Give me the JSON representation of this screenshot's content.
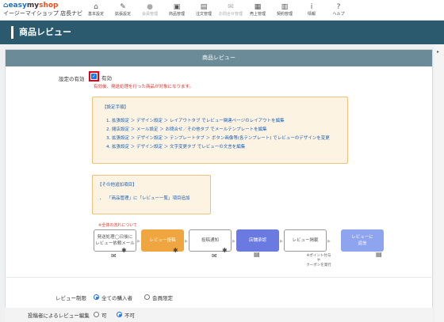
{
  "logo": {
    "brand_easy": "easy",
    "brand_my": "my",
    "brand_shop": "shop",
    "sub": "イージーマイショップ 店長ナビ"
  },
  "nav": [
    {
      "icon": "home-icon",
      "glyph": "⌂",
      "label": "基本設定",
      "dim": false
    },
    {
      "icon": "paint-icon",
      "glyph": "✎",
      "label": "拡張設定",
      "dim": false
    },
    {
      "icon": "person-icon",
      "glyph": "●",
      "label": "会員管理",
      "dim": true
    },
    {
      "icon": "gift-icon",
      "glyph": "▣",
      "label": "商品管理",
      "dim": false
    },
    {
      "icon": "document-icon",
      "glyph": "▤",
      "label": "注文管理",
      "dim": false
    },
    {
      "icon": "mail-icon",
      "glyph": "✉",
      "label": "お問合せ管理",
      "dim": true
    },
    {
      "icon": "calculator-icon",
      "glyph": "▦",
      "label": "売上管理",
      "dim": false
    },
    {
      "icon": "contract-icon",
      "glyph": "▥",
      "label": "契約管理",
      "dim": false
    },
    {
      "icon": "info-icon",
      "glyph": "i",
      "label": "情報",
      "dim": false
    },
    {
      "icon": "help-icon",
      "glyph": "?",
      "label": "ヘルプ",
      "dim": false
    }
  ],
  "page_title": "商品レビュー",
  "panel_title": "商品レビュー",
  "setting": {
    "label": "設定の有効",
    "checkbox_label": "有効",
    "note": "有効後、発送処理を行った商品が対象になります。"
  },
  "steps_box": {
    "title": "【設定手順】",
    "items": [
      "拡張設定 ＞ デザイン設定 ＞ レイアウトタブ でレビュー関連ページのレイアウトを編集",
      "閲店設定 ＞ メール設定 ＞ お問合せ／その他タブ でメールテンプレートを編集",
      "拡張設定 ＞ デザイン設定 ＞ テンプレートタブ ＞ ボタン画像等(各テンプレート) でレビューのデザインを変更",
      "拡張設定 ＞ デザイン設定 ＞ 文字変更タブ でレビューの文言を編集"
    ]
  },
  "extra_box": {
    "title": "【その他追加項目】",
    "items": [
      "「商品管理」に「レビュー一覧」項目追加"
    ]
  },
  "flow": {
    "note": "※全体の流れについて",
    "steps": [
      "発送処理◯日後に\nレビュー依頼メール",
      "レビュー投稿",
      "投稿通知",
      "店舗承認",
      "レビュー掲載",
      "レビューに\n返信"
    ],
    "sub": "※ポイント付与\nや\nクーポンを発行"
  },
  "restriction": {
    "label": "レビュー制限",
    "options": [
      {
        "text": "全ての購入者",
        "selected": true
      },
      {
        "text": "会員限定",
        "selected": false
      }
    ]
  },
  "edit": {
    "label": "投稿者によるレビュー編集",
    "options": [
      {
        "text": "可",
        "selected": false
      },
      {
        "text": "不可",
        "selected": true
      }
    ]
  }
}
